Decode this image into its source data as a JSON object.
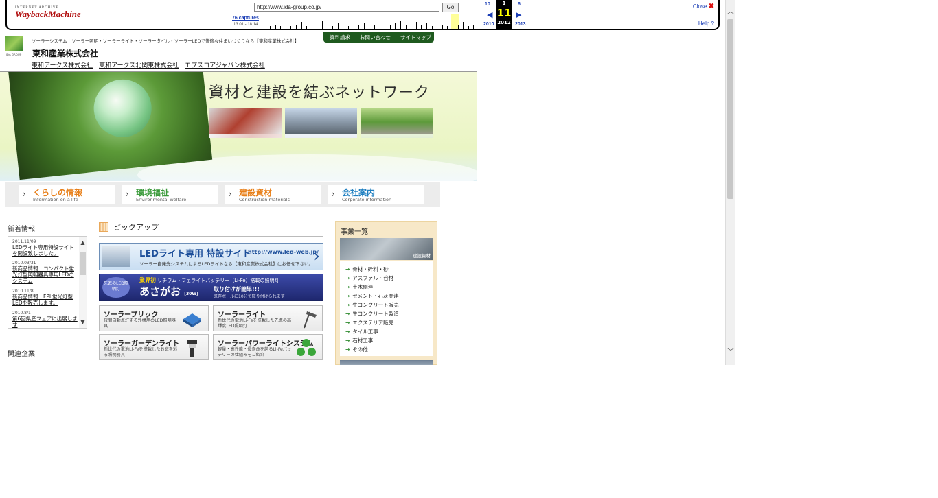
{
  "wayback": {
    "logo_top": "INTERNET ARCHIVE",
    "logo_bottom": "WaybackMachine",
    "url": "http://www.ida-group.co.jp/",
    "go_label": "Go",
    "captures": "76 captures",
    "range": "13 01 - 18 14",
    "prev_month": "10",
    "cur_month": "1",
    "next_month": "6",
    "cur_day": "11",
    "prev_year": "2010",
    "cur_year": "2012",
    "next_year": "2013",
    "close_label": "Close",
    "help_label": "Help"
  },
  "site": {
    "tagline": "ソーラーシステム｜ソーラー照明・ソーラーライト・ソーラータイル・ソーラーLEDで快適な住まいづくりなら【東和産業株式会社】",
    "logo_text": "IDA GROUP",
    "company": "東和産業株式会社",
    "affiliates": [
      "東和アークス株式会社",
      "東和アークス北関東株式会社",
      "エプスコアジャパン株式会社"
    ],
    "topnav": [
      "資料請求",
      "お問い合わせ",
      "サイトマップ"
    ],
    "hero_title": "資材と建設を結ぶネットワーク"
  },
  "categories": [
    {
      "jp": "くらしの情報",
      "en": "Information on a life",
      "color": "#e8801a"
    },
    {
      "jp": "環境福祉",
      "en": "Environmental welfare",
      "color": "#3a9a3a"
    },
    {
      "jp": "建設資材",
      "en": "Construction materials",
      "color": "#e8801a"
    },
    {
      "jp": "会社案内",
      "en": "Corporate information",
      "color": "#1f7fc0"
    }
  ],
  "news": {
    "title": "新着情報",
    "items": [
      {
        "date": "2011.11/09",
        "text": "LEDライト専用特設サイトを開設致しました。"
      },
      {
        "date": "2010.03/31",
        "text": "新商品情報　コンパクト蛍光灯型照明器具専用LEDのシステム"
      },
      {
        "date": "2010.11/8",
        "text": "新商品情報　FPL蛍光灯型LEDを販売します。"
      },
      {
        "date": "2010.8/1",
        "text": "第6回県産フェアに出展します"
      }
    ]
  },
  "related": {
    "title": "関連企業"
  },
  "pickup": {
    "title": "ピックアップ",
    "led_banner": {
      "title": "LEDライト専用 特設サイト",
      "url": "http://www.led-web.jp/",
      "sub": "ソーラー自発光システムによるLEDライトなら【東和産業株式会社】にお任せ下さい。"
    },
    "li_banner": {
      "badge": "先進のLED照明灯",
      "line1_strong": "業界初",
      "line1": "リチウム・フェライトバッテリー（Li-Fe）搭載の照明灯",
      "name": "あさがお",
      "watt": "[30W]",
      "line2": "取り付けが簡単!!!",
      "line3": "既存ポールに10分で取り付けられます"
    },
    "products": [
      {
        "name": "ソーラーブリック",
        "desc": "夜間自動点灯する外構用のLED照明器具"
      },
      {
        "name": "ソーラーライト",
        "desc": "新世代の電池Li-Feを搭載した先進の高輝度LED照明灯"
      },
      {
        "name": "ソーラーガーデンライト",
        "desc": "新世代の電池Li-Feを搭載したお庭を彩る照明器具"
      },
      {
        "name": "ソーラーパワーライトシステム",
        "desc": "軽量・高性能・長寿命を誇るLi-Feバッテリーの仕組みをご紹介"
      }
    ]
  },
  "business": {
    "title": "事業一覧",
    "image_label": "建設資材",
    "items": [
      "骨材・砕料・砂",
      "アスファルト合材",
      "土木関連",
      "セメント・石灰関連",
      "生コンクリート販売",
      "生コンクリート製造",
      "エクステリア販売",
      "タイル工事",
      "石材工事",
      "その他"
    ]
  }
}
